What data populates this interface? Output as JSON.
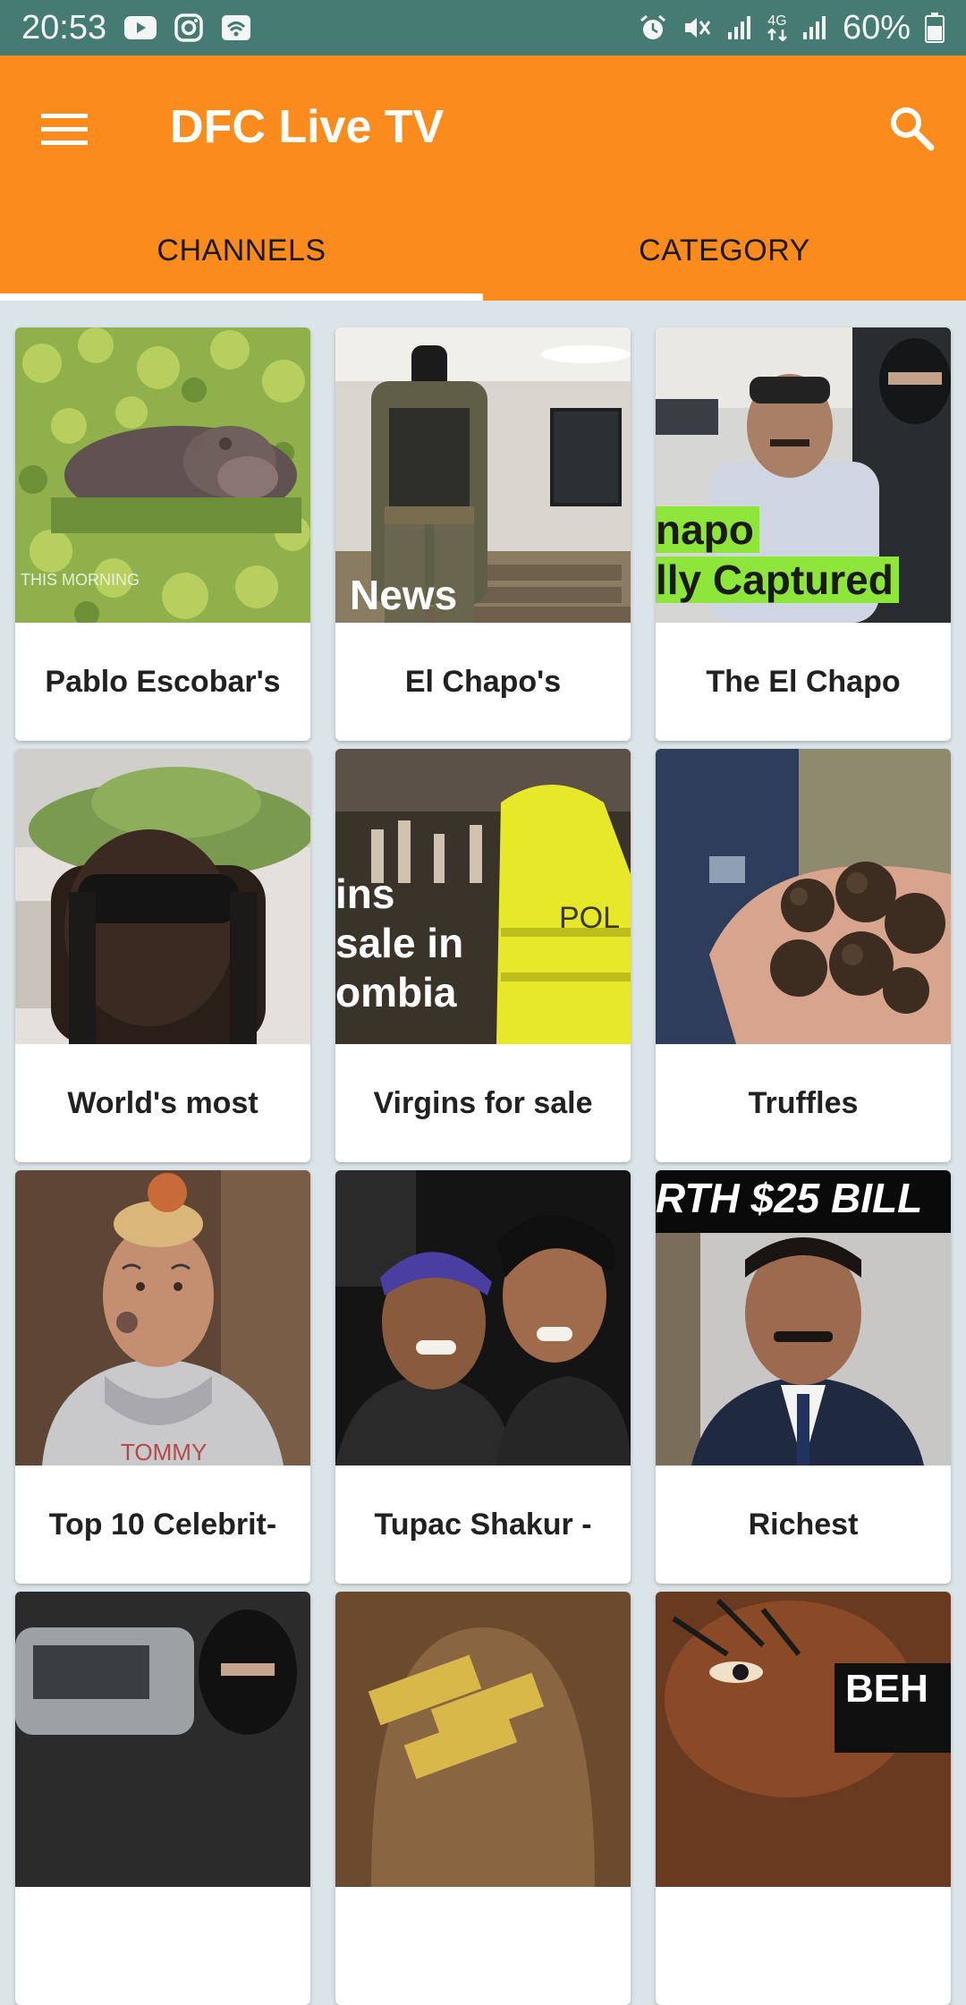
{
  "status_bar": {
    "time": "20:53",
    "battery": "60%",
    "network_label": "4G",
    "icons": [
      "youtube-icon",
      "instagram-icon",
      "wifi-calling-icon",
      "alarm-icon",
      "mute-icon",
      "signal-icon",
      "data-arrows-icon",
      "signal-icon",
      "battery-icon"
    ]
  },
  "app_bar": {
    "title": "DFC Live TV",
    "menu_icon": "hamburger-menu-icon",
    "search_icon": "search-icon",
    "background": "#fb8b1c"
  },
  "tabs": [
    {
      "label": "CHANNELS",
      "selected": true
    },
    {
      "label": "CATEGORY",
      "selected": false
    }
  ],
  "channels": [
    {
      "title": "Pablo Escobar's",
      "thumb_text": "THIS MORNING"
    },
    {
      "title": "El Chapo's",
      "thumb_text": "News"
    },
    {
      "title": "The El Chapo",
      "thumb_text_1": "napo",
      "thumb_text_2": "lly Captured"
    },
    {
      "title": "World's most",
      "thumb_text": ""
    },
    {
      "title": "Virgins for sale",
      "thumb_text_1": "ins",
      "thumb_text_2": "sale in",
      "thumb_text_3": "ombia",
      "thumb_text_4": "POL"
    },
    {
      "title": "Truffles",
      "thumb_text": ""
    },
    {
      "title": "Top 10 Celebrit-",
      "thumb_text": "TOMMY"
    },
    {
      "title": "Tupac Shakur -",
      "thumb_text": ""
    },
    {
      "title": "Richest",
      "thumb_text": "RTH $25 BILL"
    },
    {
      "title": "",
      "thumb_text": ""
    },
    {
      "title": "",
      "thumb_text": ""
    },
    {
      "title": "",
      "thumb_text": "BEH"
    }
  ],
  "colors": {
    "status_bar": "#467b73",
    "accent": "#fb8b1c",
    "background": "#dbe4e8"
  }
}
